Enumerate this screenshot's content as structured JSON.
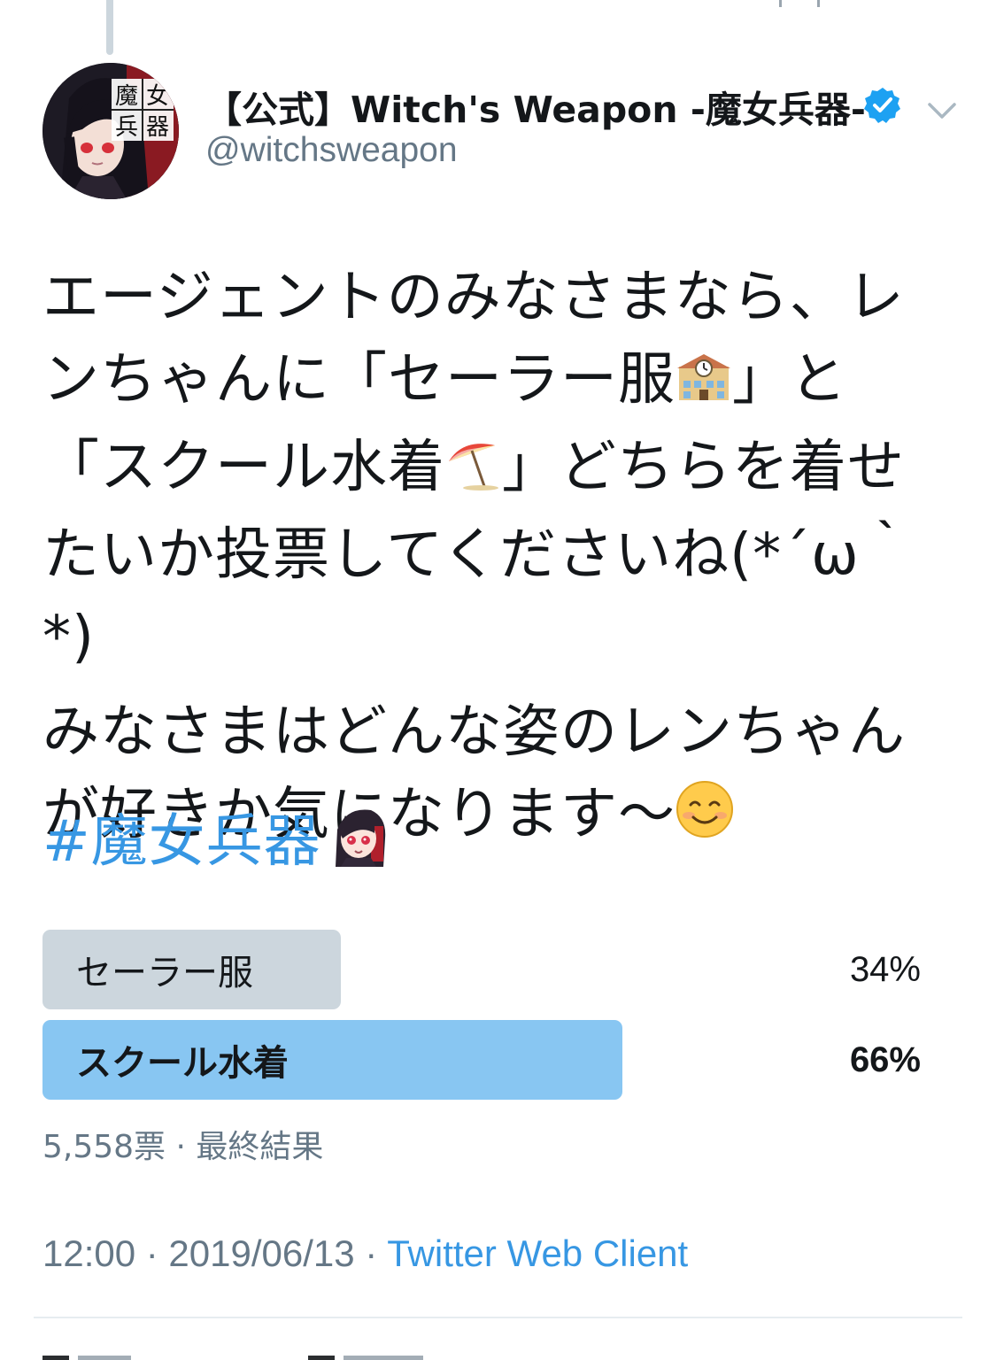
{
  "tweet": {
    "author": {
      "display_name": "【公式】Witch's Weapon -魔女兵器-",
      "handle": "@witchsweapon",
      "verified": true,
      "avatar_badge": "魔女兵器"
    },
    "paragraphs": [
      {
        "line1": "エージェントのみなさまなら、レ",
        "line2a": "ンちゃんに「セーラー服",
        "line2b": "」と",
        "line3a": "「スクール水着",
        "line3b": "」どちらを着せ",
        "line4": "たいか投票してくださいね(*´ω｀*)"
      },
      {
        "line1": "みなさまはどんな姿のレンちゃん",
        "line2": "が好きか気になります〜"
      }
    ],
    "emojis": {
      "school": "school-icon",
      "umbrella": "beach-umbrella-icon",
      "smile": "smiling-face-icon",
      "hashtag_character": "hashtag-character-icon"
    },
    "hashtag": "#魔女兵器",
    "poll": {
      "options": [
        {
          "label": "セーラー服",
          "percent_text": "34%",
          "fraction": 0.34,
          "winner": false,
          "color": "#ccd6dd"
        },
        {
          "label": "スクール水着",
          "percent_text": "66%",
          "fraction": 0.66,
          "winner": true,
          "color": "#88c6f2"
        }
      ],
      "meta": "5,558票 · 最終結果"
    },
    "timestamp": "12:00 · 2019/06/13 · ",
    "source": "Twitter Web Client"
  },
  "colors": {
    "text": "#14171a",
    "secondary": "#657786",
    "link": "#3797e3",
    "verified": "#1da1f2",
    "divider": "#e6ecf0"
  }
}
